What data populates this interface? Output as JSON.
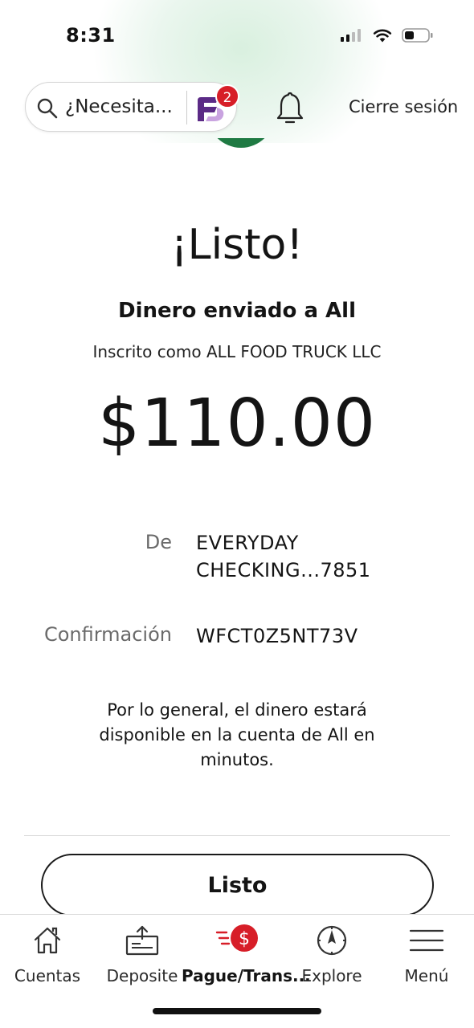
{
  "status_bar": {
    "time": "8:31"
  },
  "header": {
    "search_placeholder": "¿Necesita...",
    "notification_count": "2",
    "logout_label": "Cierre sesión"
  },
  "confirmation": {
    "headline": "¡Listo!",
    "sent_to": "Dinero enviado a All",
    "enrolled_as": "Inscrito como ALL FOOD TRUCK LLC",
    "amount": "$110.00",
    "from_label": "De",
    "from_value": "EVERYDAY CHECKING...7851",
    "confirmation_label": "Confirmación",
    "confirmation_value": "WFCT0Z5NT73V",
    "note": "Por lo general, el dinero estará disponible en la cuenta de All en minutos.",
    "done_button": "Listo"
  },
  "tabbar": {
    "items": [
      {
        "label": "Cuentas",
        "icon": "home-icon",
        "active": false
      },
      {
        "label": "Deposite",
        "icon": "deposit-icon",
        "active": false
      },
      {
        "label": "Pague/Trans...",
        "icon": "pay-transfer-icon",
        "active": true
      },
      {
        "label": "Explore",
        "icon": "compass-icon",
        "active": false
      },
      {
        "label": "Menú",
        "icon": "menu-icon",
        "active": false
      }
    ]
  },
  "colors": {
    "brand_red": "#d71e28",
    "brand_green": "#1f7a43",
    "assistant_purple": "#5b2a86"
  }
}
